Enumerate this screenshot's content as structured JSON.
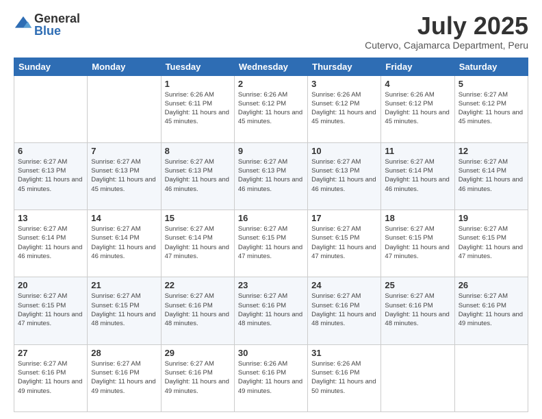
{
  "logo": {
    "general": "General",
    "blue": "Blue"
  },
  "header": {
    "month": "July 2025",
    "location": "Cutervo, Cajamarca Department, Peru"
  },
  "weekdays": [
    "Sunday",
    "Monday",
    "Tuesday",
    "Wednesday",
    "Thursday",
    "Friday",
    "Saturday"
  ],
  "weeks": [
    [
      {
        "day": "",
        "info": ""
      },
      {
        "day": "",
        "info": ""
      },
      {
        "day": "1",
        "info": "Sunrise: 6:26 AM\nSunset: 6:11 PM\nDaylight: 11 hours and 45 minutes."
      },
      {
        "day": "2",
        "info": "Sunrise: 6:26 AM\nSunset: 6:12 PM\nDaylight: 11 hours and 45 minutes."
      },
      {
        "day": "3",
        "info": "Sunrise: 6:26 AM\nSunset: 6:12 PM\nDaylight: 11 hours and 45 minutes."
      },
      {
        "day": "4",
        "info": "Sunrise: 6:26 AM\nSunset: 6:12 PM\nDaylight: 11 hours and 45 minutes."
      },
      {
        "day": "5",
        "info": "Sunrise: 6:27 AM\nSunset: 6:12 PM\nDaylight: 11 hours and 45 minutes."
      }
    ],
    [
      {
        "day": "6",
        "info": "Sunrise: 6:27 AM\nSunset: 6:13 PM\nDaylight: 11 hours and 45 minutes."
      },
      {
        "day": "7",
        "info": "Sunrise: 6:27 AM\nSunset: 6:13 PM\nDaylight: 11 hours and 45 minutes."
      },
      {
        "day": "8",
        "info": "Sunrise: 6:27 AM\nSunset: 6:13 PM\nDaylight: 11 hours and 46 minutes."
      },
      {
        "day": "9",
        "info": "Sunrise: 6:27 AM\nSunset: 6:13 PM\nDaylight: 11 hours and 46 minutes."
      },
      {
        "day": "10",
        "info": "Sunrise: 6:27 AM\nSunset: 6:13 PM\nDaylight: 11 hours and 46 minutes."
      },
      {
        "day": "11",
        "info": "Sunrise: 6:27 AM\nSunset: 6:14 PM\nDaylight: 11 hours and 46 minutes."
      },
      {
        "day": "12",
        "info": "Sunrise: 6:27 AM\nSunset: 6:14 PM\nDaylight: 11 hours and 46 minutes."
      }
    ],
    [
      {
        "day": "13",
        "info": "Sunrise: 6:27 AM\nSunset: 6:14 PM\nDaylight: 11 hours and 46 minutes."
      },
      {
        "day": "14",
        "info": "Sunrise: 6:27 AM\nSunset: 6:14 PM\nDaylight: 11 hours and 46 minutes."
      },
      {
        "day": "15",
        "info": "Sunrise: 6:27 AM\nSunset: 6:14 PM\nDaylight: 11 hours and 47 minutes."
      },
      {
        "day": "16",
        "info": "Sunrise: 6:27 AM\nSunset: 6:15 PM\nDaylight: 11 hours and 47 minutes."
      },
      {
        "day": "17",
        "info": "Sunrise: 6:27 AM\nSunset: 6:15 PM\nDaylight: 11 hours and 47 minutes."
      },
      {
        "day": "18",
        "info": "Sunrise: 6:27 AM\nSunset: 6:15 PM\nDaylight: 11 hours and 47 minutes."
      },
      {
        "day": "19",
        "info": "Sunrise: 6:27 AM\nSunset: 6:15 PM\nDaylight: 11 hours and 47 minutes."
      }
    ],
    [
      {
        "day": "20",
        "info": "Sunrise: 6:27 AM\nSunset: 6:15 PM\nDaylight: 11 hours and 47 minutes."
      },
      {
        "day": "21",
        "info": "Sunrise: 6:27 AM\nSunset: 6:15 PM\nDaylight: 11 hours and 48 minutes."
      },
      {
        "day": "22",
        "info": "Sunrise: 6:27 AM\nSunset: 6:16 PM\nDaylight: 11 hours and 48 minutes."
      },
      {
        "day": "23",
        "info": "Sunrise: 6:27 AM\nSunset: 6:16 PM\nDaylight: 11 hours and 48 minutes."
      },
      {
        "day": "24",
        "info": "Sunrise: 6:27 AM\nSunset: 6:16 PM\nDaylight: 11 hours and 48 minutes."
      },
      {
        "day": "25",
        "info": "Sunrise: 6:27 AM\nSunset: 6:16 PM\nDaylight: 11 hours and 48 minutes."
      },
      {
        "day": "26",
        "info": "Sunrise: 6:27 AM\nSunset: 6:16 PM\nDaylight: 11 hours and 49 minutes."
      }
    ],
    [
      {
        "day": "27",
        "info": "Sunrise: 6:27 AM\nSunset: 6:16 PM\nDaylight: 11 hours and 49 minutes."
      },
      {
        "day": "28",
        "info": "Sunrise: 6:27 AM\nSunset: 6:16 PM\nDaylight: 11 hours and 49 minutes."
      },
      {
        "day": "29",
        "info": "Sunrise: 6:27 AM\nSunset: 6:16 PM\nDaylight: 11 hours and 49 minutes."
      },
      {
        "day": "30",
        "info": "Sunrise: 6:26 AM\nSunset: 6:16 PM\nDaylight: 11 hours and 49 minutes."
      },
      {
        "day": "31",
        "info": "Sunrise: 6:26 AM\nSunset: 6:16 PM\nDaylight: 11 hours and 50 minutes."
      },
      {
        "day": "",
        "info": ""
      },
      {
        "day": "",
        "info": ""
      }
    ]
  ]
}
